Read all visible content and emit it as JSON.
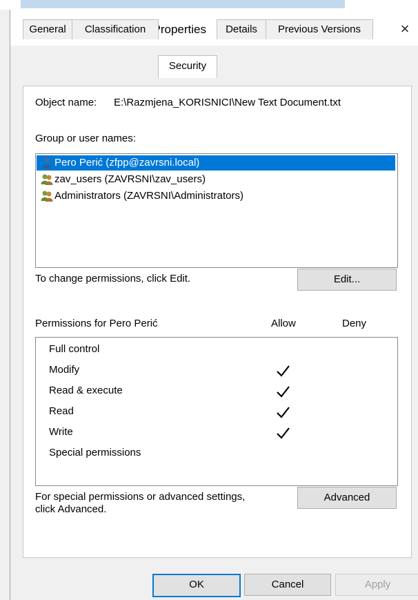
{
  "window": {
    "title": "New Text Document Properties",
    "close_symbol": "×"
  },
  "tabs": [
    {
      "label": "General",
      "active": false
    },
    {
      "label": "Classification",
      "active": false
    },
    {
      "label": "Security",
      "active": true
    },
    {
      "label": "Details",
      "active": false
    },
    {
      "label": "Previous Versions",
      "active": false
    }
  ],
  "security": {
    "object_name_label": "Object name:",
    "object_name_value": "E:\\Razmjena_KORISNICI\\New Text Document.txt",
    "group_label": "Group or user names:",
    "users": [
      {
        "name": "Pero Perić (zfpp@zavrsni.local)",
        "icon": "single-user-icon",
        "selected": true
      },
      {
        "name": "zav_users (ZAVRSNI\\zav_users)",
        "icon": "group-users-icon",
        "selected": false
      },
      {
        "name": "Administrators (ZAVRSNI\\Administrators)",
        "icon": "group-users-icon",
        "selected": false
      }
    ],
    "change_text": "To change permissions, click Edit.",
    "edit_button": "Edit...",
    "permissions_for": "Permissions for Pero Perić",
    "allow_header": "Allow",
    "deny_header": "Deny",
    "permissions": [
      {
        "name": "Full control",
        "allow": false,
        "deny": false
      },
      {
        "name": "Modify",
        "allow": true,
        "deny": false
      },
      {
        "name": "Read & execute",
        "allow": true,
        "deny": false
      },
      {
        "name": "Read",
        "allow": true,
        "deny": false
      },
      {
        "name": "Write",
        "allow": true,
        "deny": false
      },
      {
        "name": "Special permissions",
        "allow": false,
        "deny": false
      }
    ],
    "special_text_line1": "For special permissions or advanced settings,",
    "special_text_line2": "click Advanced.",
    "advanced_button": "Advanced"
  },
  "footer": {
    "ok": "OK",
    "cancel": "Cancel",
    "apply": "Apply"
  },
  "colors": {
    "selection": "#0078d7",
    "check": "#000000",
    "disabled_text": "#a0a0a0"
  }
}
